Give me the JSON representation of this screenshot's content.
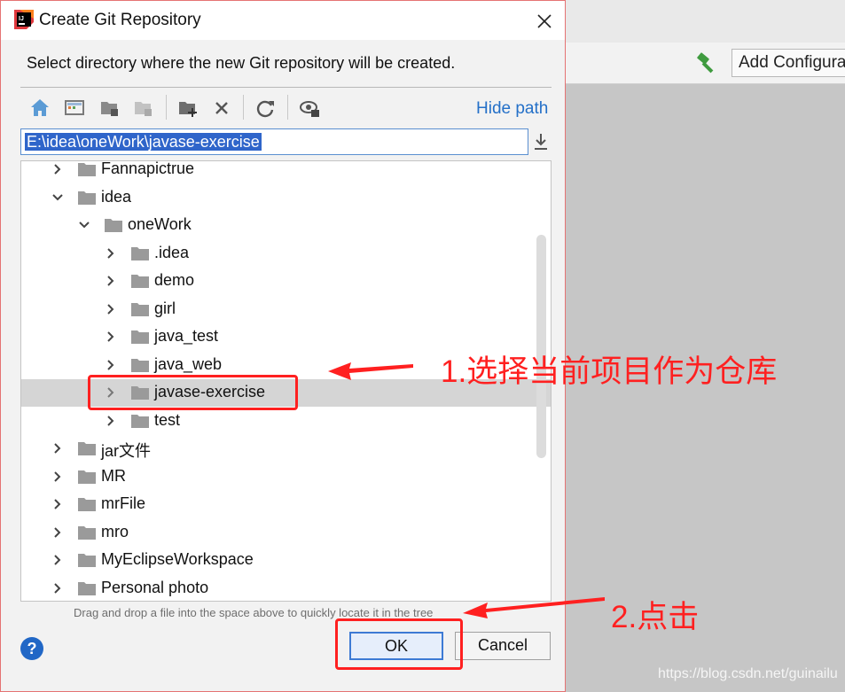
{
  "ide": {
    "add_configuration": "Add Configura"
  },
  "dialog": {
    "title": "Create Git Repository",
    "instruction": "Select directory where the new Git repository will be created.",
    "hide_path": "Hide path",
    "path": "E:\\idea\\oneWork\\javase-exercise",
    "tree": [
      {
        "label": "Fannapictrue",
        "depth": 0,
        "expanded": false,
        "selected": false
      },
      {
        "label": "idea",
        "depth": 0,
        "expanded": true,
        "selected": false
      },
      {
        "label": "oneWork",
        "depth": 1,
        "expanded": true,
        "selected": false
      },
      {
        "label": ".idea",
        "depth": 2,
        "expanded": false,
        "selected": false
      },
      {
        "label": "demo",
        "depth": 2,
        "expanded": false,
        "selected": false
      },
      {
        "label": "girl",
        "depth": 2,
        "expanded": false,
        "selected": false
      },
      {
        "label": "java_test",
        "depth": 2,
        "expanded": false,
        "selected": false
      },
      {
        "label": "java_web",
        "depth": 2,
        "expanded": false,
        "selected": false
      },
      {
        "label": "javase-exercise",
        "depth": 2,
        "expanded": false,
        "selected": true
      },
      {
        "label": "test",
        "depth": 2,
        "expanded": false,
        "selected": false
      },
      {
        "label": "jar文件",
        "depth": 0,
        "expanded": false,
        "selected": false
      },
      {
        "label": "MR",
        "depth": 0,
        "expanded": false,
        "selected": false
      },
      {
        "label": "mrFile",
        "depth": 0,
        "expanded": false,
        "selected": false
      },
      {
        "label": "mro",
        "depth": 0,
        "expanded": false,
        "selected": false
      },
      {
        "label": "MyEclipseWorkspace",
        "depth": 0,
        "expanded": false,
        "selected": false
      },
      {
        "label": "Personal photo",
        "depth": 0,
        "expanded": false,
        "selected": false
      }
    ],
    "hint": "Drag and drop a file into the space above to quickly locate it in the tree",
    "help": "?",
    "ok": "OK",
    "cancel": "Cancel"
  },
  "annotations": {
    "step1": "1.选择当前项目作为仓库",
    "step2": "2.点击",
    "color": "#ff2020"
  },
  "watermark": "https://blog.csdn.net/guinailu"
}
